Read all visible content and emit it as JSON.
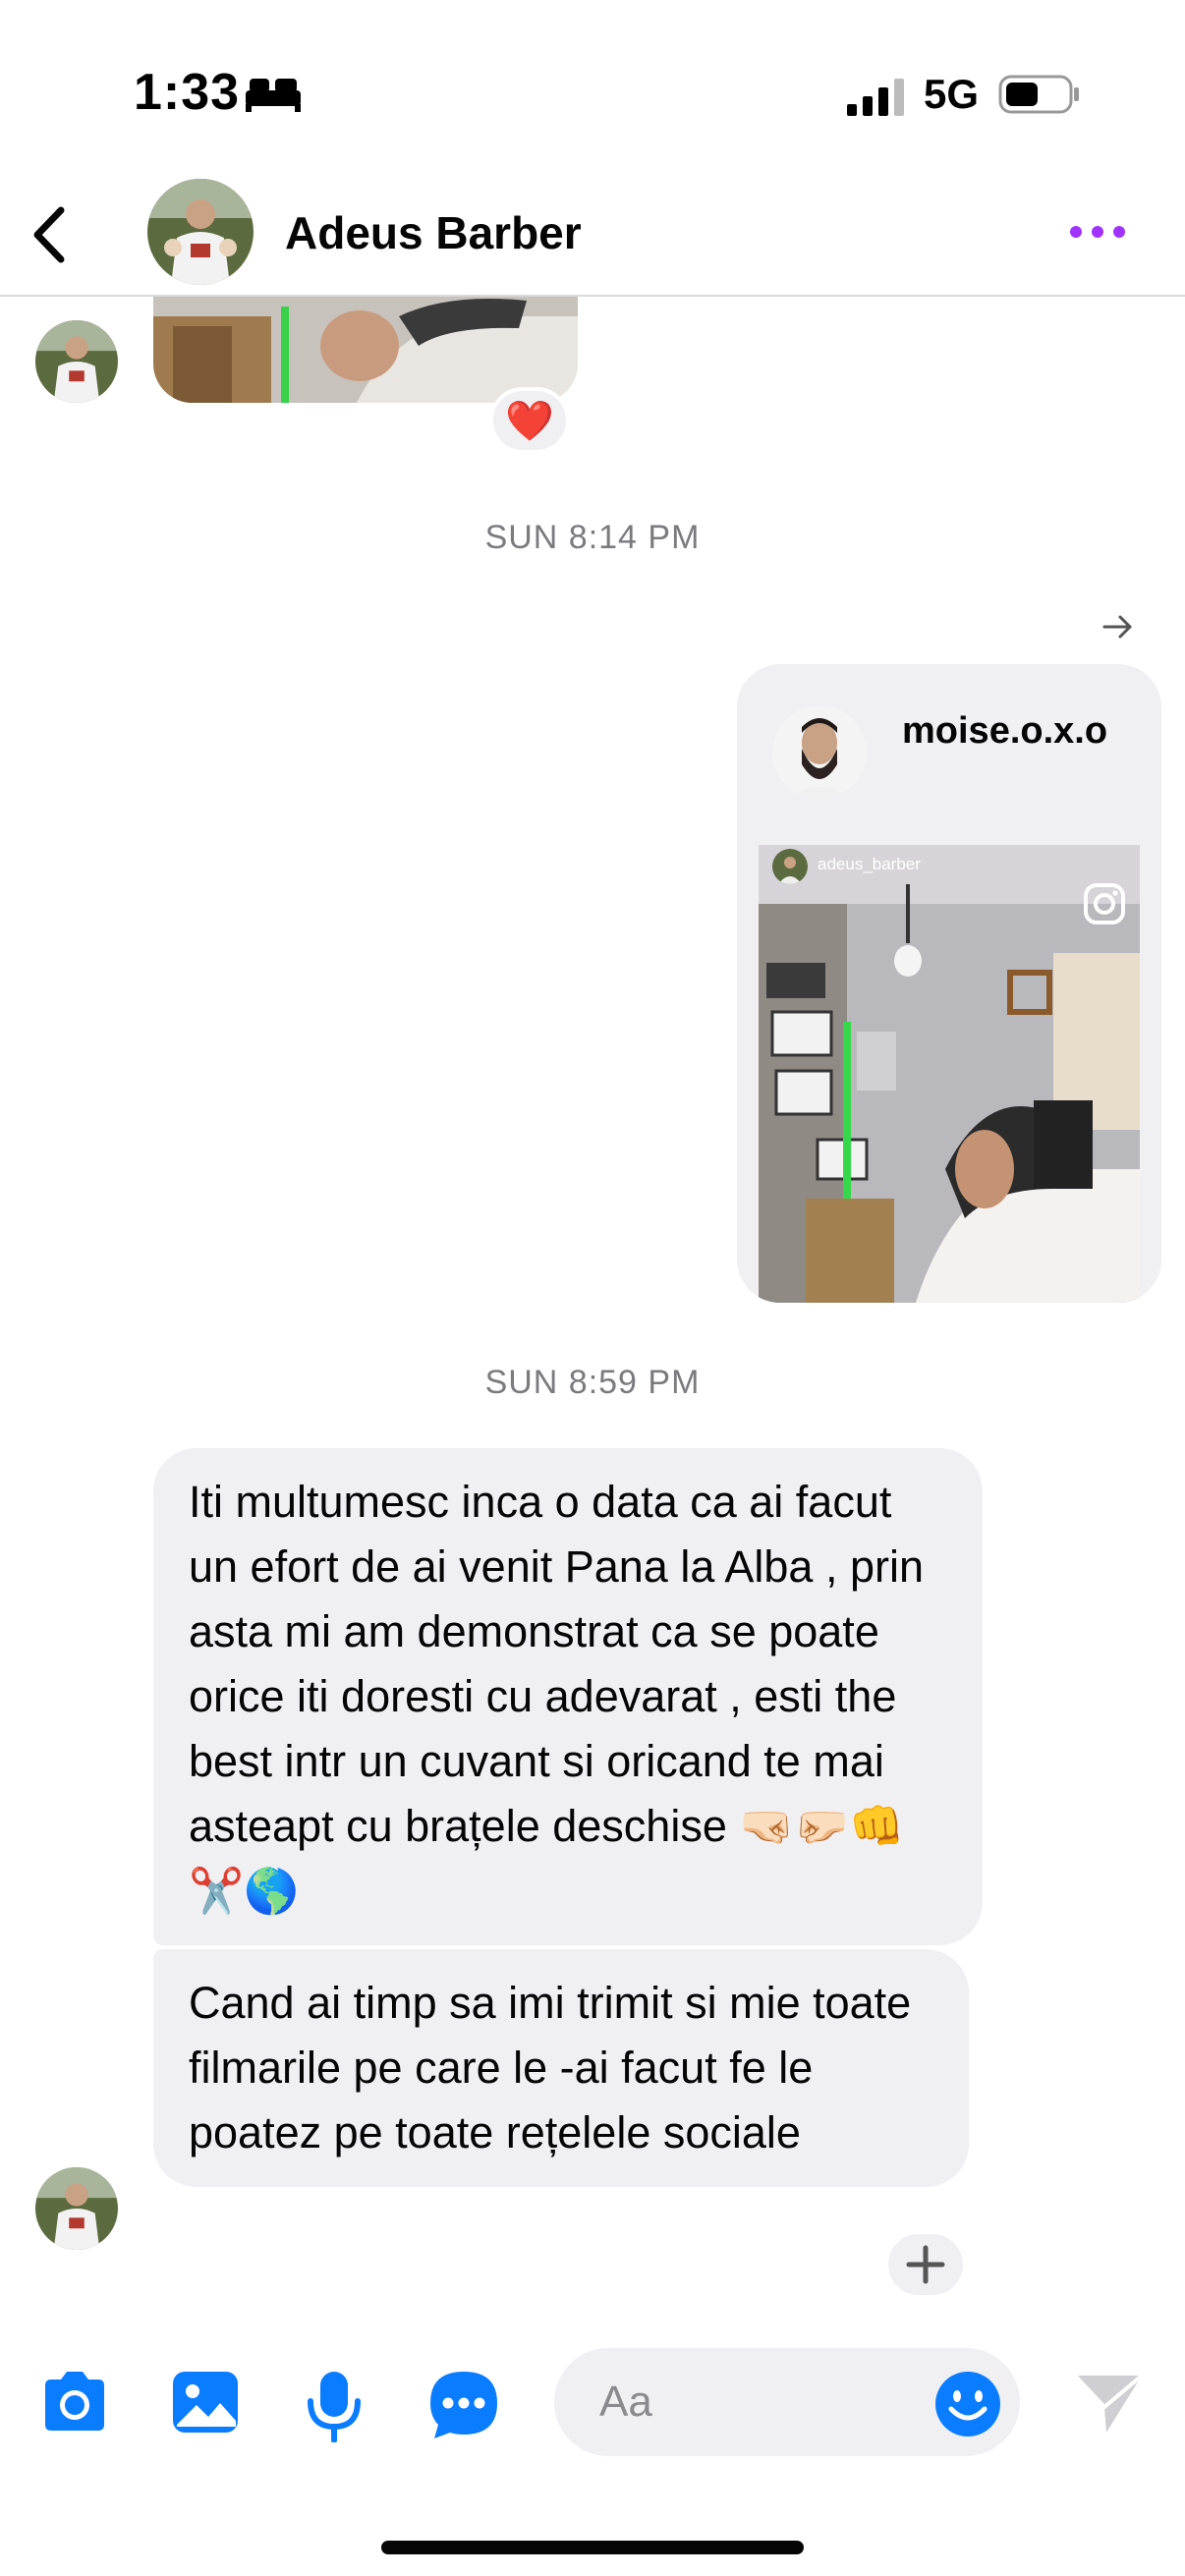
{
  "status_bar": {
    "time": "1:33",
    "network": "5G"
  },
  "header": {
    "contact_name": "Adeus Barber"
  },
  "messages": {
    "photo_reaction": "❤️",
    "timestamp_1": "SUN 8:14 PM",
    "shared_post": {
      "username": "moise.o.x.o",
      "reel_username": "adeus_barber"
    },
    "timestamp_2": "SUN 8:59 PM",
    "bubble_1": "Iti multumesc inca o data ca ai facut un efort de ai venit Pana la Alba , prin asta mi am demonstrat ca se poate orice iti doresti cu adevarat , esti the best intr un cuvant si oricand te mai asteapt cu brațele deschise 🤜🏻🤛🏻👊✂️🌎",
    "bubble_2": "Cand ai timp sa imi trimit si mie toate filmarile pe care le -ai facut fe le poatez pe toate rețelele sociale"
  },
  "composer": {
    "placeholder": "Aa"
  },
  "colors": {
    "accent": "#0a7cff",
    "more": "#a033ff",
    "bubble": "#f0f0f3"
  },
  "icons": [
    "back-icon",
    "more-icon",
    "camera-icon",
    "image-icon",
    "microphone-icon",
    "chat-more-icon",
    "emoji-icon",
    "send-icon",
    "instagram-icon",
    "forward-icon",
    "plus-icon"
  ]
}
